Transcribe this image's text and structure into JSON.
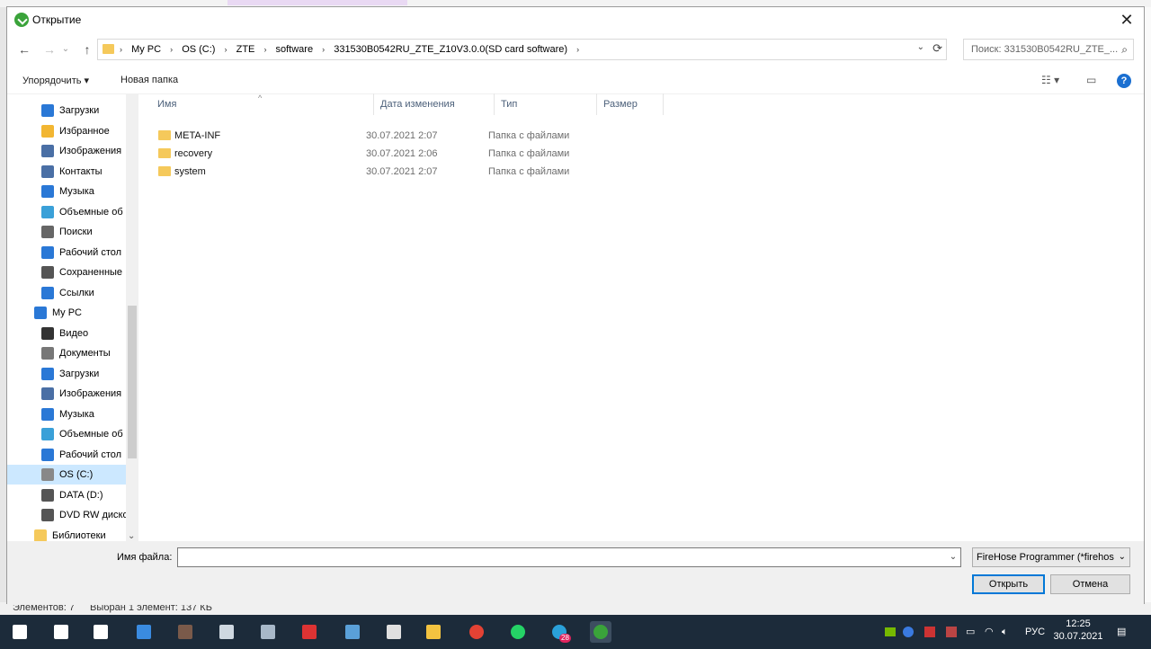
{
  "window": {
    "title": "Открытие",
    "close": "✕"
  },
  "nav": {
    "back": "←",
    "forward": "→",
    "up": "↑",
    "dropdown": "⌄",
    "breadcrumbs": [
      "My PC",
      "OS (C:)",
      "ZTE",
      "software",
      "331530B0542RU_ZTE_Z10V3.0.0(SD card software)"
    ],
    "search_placeholder": "Поиск: 331530B0542RU_ZTE_..."
  },
  "toolbar": {
    "organize": "Упорядочить ▾",
    "new_folder": "Новая папка",
    "view": "☷ ▾",
    "pane": "▭",
    "help": "?"
  },
  "sidebar": {
    "items": [
      {
        "label": "Загрузки",
        "icon": "download-icon",
        "color": "#2a78d6"
      },
      {
        "label": "Избранное",
        "icon": "star-icon",
        "color": "#f2b632"
      },
      {
        "label": "Изображения",
        "icon": "pictures-icon",
        "color": "#4a6fa5"
      },
      {
        "label": "Контакты",
        "icon": "contacts-icon",
        "color": "#4a6fa5"
      },
      {
        "label": "Музыка",
        "icon": "music-icon",
        "color": "#2a78d6"
      },
      {
        "label": "Объемные об",
        "icon": "3d-objects-icon",
        "color": "#3aa0d8"
      },
      {
        "label": "Поиски",
        "icon": "search-icon",
        "color": "#666666"
      },
      {
        "label": "Рабочий стол",
        "icon": "desktop-icon",
        "color": "#2a78d6"
      },
      {
        "label": "Сохраненные",
        "icon": "saved-games-icon",
        "color": "#555555"
      },
      {
        "label": "Ссылки",
        "icon": "links-icon",
        "color": "#2a78d6"
      },
      {
        "label": "My PC",
        "icon": "computer-icon",
        "color": "#2a78d6"
      },
      {
        "label": "Видео",
        "icon": "video-icon",
        "color": "#333333"
      },
      {
        "label": "Документы",
        "icon": "documents-icon",
        "color": "#777777"
      },
      {
        "label": "Загрузки",
        "icon": "download-icon",
        "color": "#2a78d6"
      },
      {
        "label": "Изображения",
        "icon": "pictures-icon",
        "color": "#4a6fa5"
      },
      {
        "label": "Музыка",
        "icon": "music-icon",
        "color": "#2a78d6"
      },
      {
        "label": "Объемные об",
        "icon": "3d-objects-icon",
        "color": "#3aa0d8"
      },
      {
        "label": "Рабочий стол",
        "icon": "desktop-icon",
        "color": "#2a78d6"
      },
      {
        "label": "OS (C:)",
        "icon": "drive-icon",
        "color": "#888888",
        "selected": true
      },
      {
        "label": "DATA (D:)",
        "icon": "drive-icon",
        "color": "#555555"
      },
      {
        "label": "DVD RW диско",
        "icon": "dvd-drive-icon",
        "color": "#555555"
      },
      {
        "label": "Библиотеки",
        "icon": "libraries-icon",
        "color": "#f5c95b"
      }
    ]
  },
  "columns": {
    "name": "Имя",
    "date": "Дата изменения",
    "type": "Тип",
    "size": "Размер"
  },
  "files": [
    {
      "name": "META-INF",
      "date": "30.07.2021 2:07",
      "type": "Папка с файлами"
    },
    {
      "name": "recovery",
      "date": "30.07.2021 2:06",
      "type": "Папка с файлами"
    },
    {
      "name": "system",
      "date": "30.07.2021 2:07",
      "type": "Папка с файлами"
    }
  ],
  "bottom": {
    "filename_label": "Имя файла:",
    "filename_value": "",
    "filter": "FireHose Programmer (*firehos",
    "open": "Открыть",
    "cancel": "Отмена"
  },
  "background_status": {
    "elements": "Элементов: 7",
    "selected": "Выбран 1 элемент: 137 КБ"
  },
  "taskbar": {
    "language": "РУС",
    "time": "12:25",
    "date": "30.07.2021",
    "badge": "28",
    "icons": [
      "windows-start-icon",
      "search-icon",
      "task-view-icon",
      "app-icon",
      "winrar-icon",
      "settings-icon",
      "photos-icon",
      "tool-icon",
      "remote-desktop-icon",
      "calculator-icon",
      "file-explorer-icon",
      "chrome-icon",
      "whatsapp-icon",
      "telegram-icon",
      "downloader-icon"
    ]
  }
}
